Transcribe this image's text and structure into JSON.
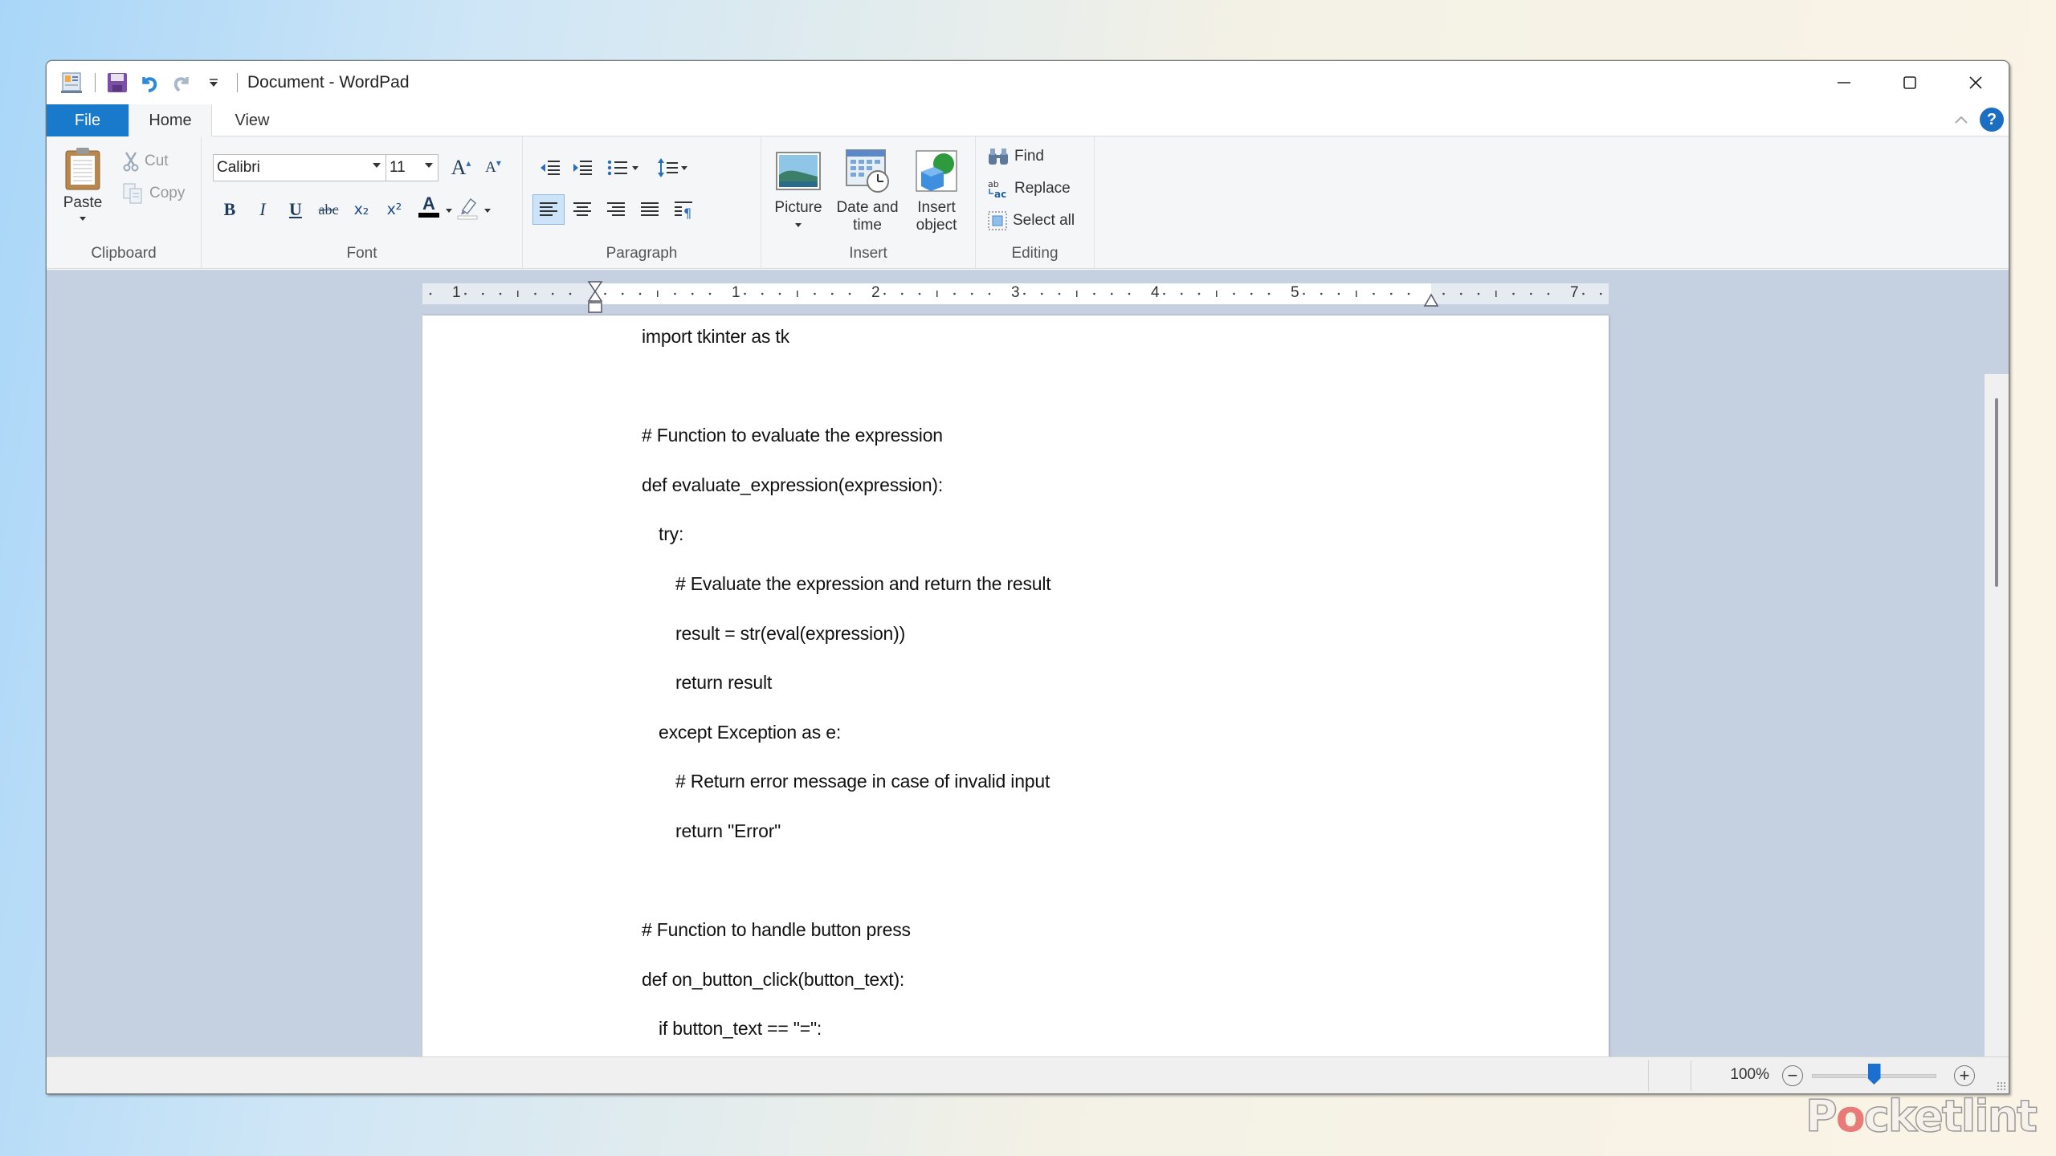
{
  "window": {
    "title": "Document - WordPad",
    "qat_icons": [
      "wordpad-app-icon",
      "save-icon",
      "undo-icon",
      "redo-icon",
      "customize-qat-icon"
    ]
  },
  "window_controls": {
    "minimize": "minimize",
    "maximize": "maximize",
    "close": "close"
  },
  "tabs": [
    {
      "label": "File",
      "active": false
    },
    {
      "label": "Home",
      "active": true
    },
    {
      "label": "View",
      "active": false
    }
  ],
  "ribbon": {
    "clipboard": {
      "label": "Clipboard",
      "paste": "Paste",
      "cut": "Cut",
      "copy": "Copy"
    },
    "font": {
      "label": "Font",
      "family": "Calibri",
      "size": "11",
      "grow": "A",
      "shrink": "A",
      "bold": "B",
      "italic": "I",
      "underline": "U",
      "strikethrough": "abc",
      "subscript": "x₂",
      "superscript": "x²",
      "text_color": "A",
      "text_color_hex": "#000000"
    },
    "paragraph": {
      "label": "Paragraph",
      "active_alignment": "left"
    },
    "insert": {
      "label": "Insert",
      "picture": "Picture",
      "datetime_line1": "Date and",
      "datetime_line2": "time",
      "object_line1": "Insert",
      "object_line2": "object"
    },
    "editing": {
      "label": "Editing",
      "find": "Find",
      "replace": "Replace",
      "select_all": "Select all"
    }
  },
  "ruler": {
    "numbers": [
      "1",
      "1",
      "2",
      "3",
      "4",
      "5",
      "7"
    ]
  },
  "document": {
    "lines": [
      {
        "indent": 0,
        "text": "import tkinter as tk"
      },
      {
        "indent": 0,
        "text": ""
      },
      {
        "indent": 0,
        "text": "# Function to evaluate the expression"
      },
      {
        "indent": 0,
        "text": "def evaluate_expression(expression):"
      },
      {
        "indent": 1,
        "text": "try:"
      },
      {
        "indent": 2,
        "text": "# Evaluate the expression and return the result"
      },
      {
        "indent": 2,
        "text": "result = str(eval(expression))"
      },
      {
        "indent": 2,
        "text": "return result"
      },
      {
        "indent": 1,
        "text": "except Exception as e:"
      },
      {
        "indent": 2,
        "text": "# Return error message in case of invalid input"
      },
      {
        "indent": 2,
        "text": "return \"Error\""
      },
      {
        "indent": 0,
        "text": ""
      },
      {
        "indent": 0,
        "text": "# Function to handle button press"
      },
      {
        "indent": 0,
        "text": "def on_button_click(button_text):"
      },
      {
        "indent": 1,
        "text": "if button_text == \"=\":"
      }
    ]
  },
  "statusbar": {
    "zoom_label": "100%",
    "zoom_percent": 100,
    "zoom_out": "−",
    "zoom_in": "+"
  },
  "watermark": {
    "pre": "P",
    "o": "o",
    "post": "cketlint"
  },
  "colors": {
    "file_tab": "#1979ca",
    "accent": "#1a6fd0",
    "doc_background": "#c5d0e1"
  }
}
